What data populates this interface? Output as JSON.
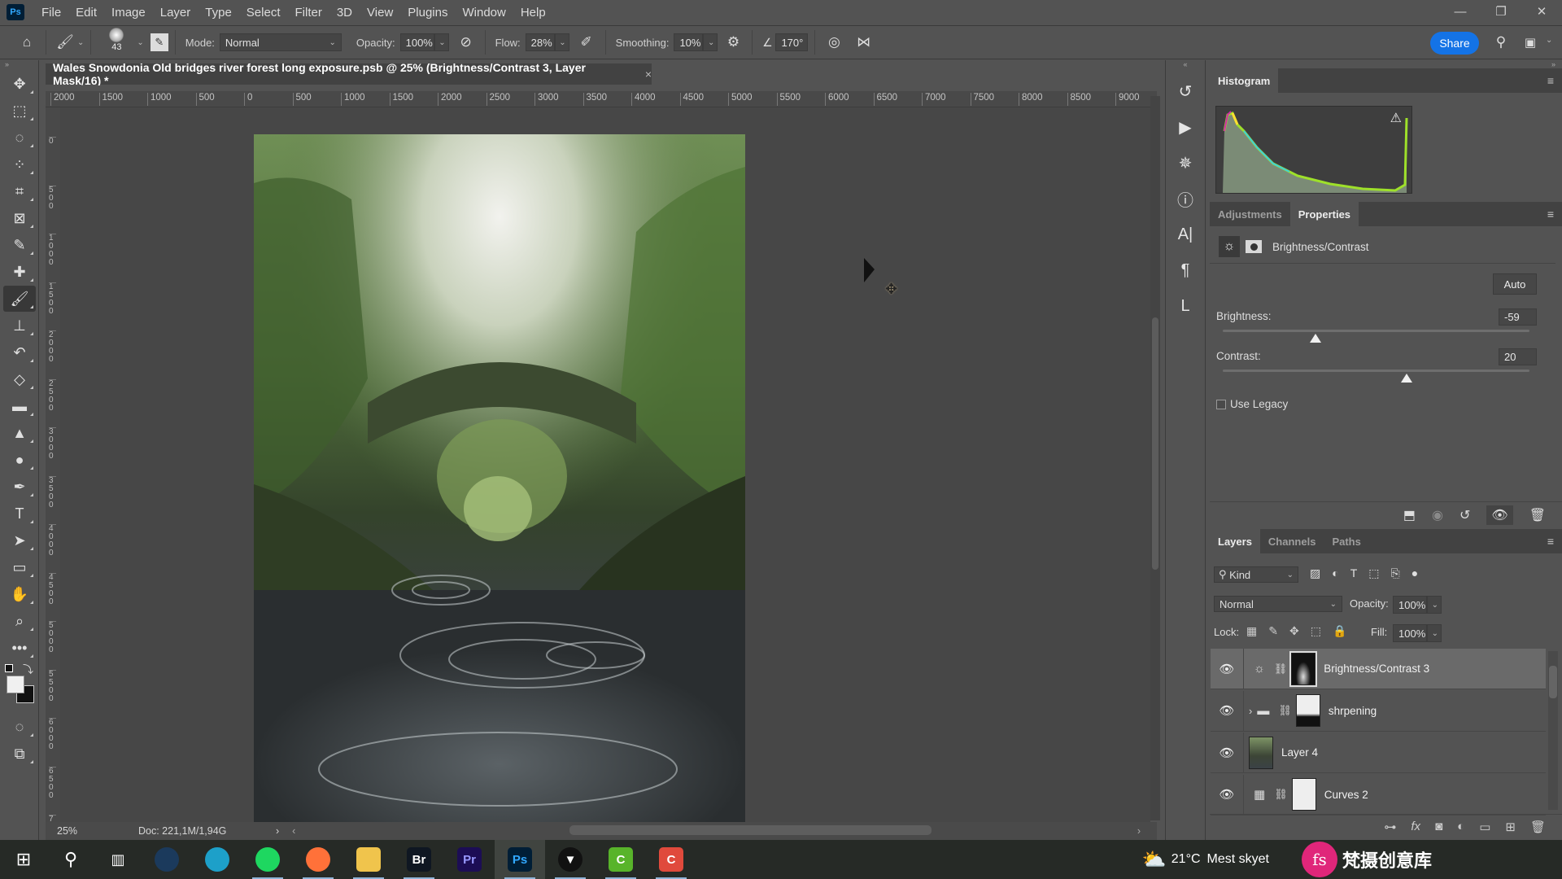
{
  "app": {
    "logo": "Ps",
    "name": "Adobe Photoshop"
  },
  "menu": [
    "File",
    "Edit",
    "Image",
    "Layer",
    "Type",
    "Select",
    "Filter",
    "3D",
    "View",
    "Plugins",
    "Window",
    "Help"
  ],
  "window_controls": {
    "minimize": "—",
    "restore": "❐",
    "close": "✕"
  },
  "options_bar": {
    "brush_size": "43",
    "mode_label": "Mode:",
    "mode_value": "Normal",
    "opacity_label": "Opacity:",
    "opacity_value": "100%",
    "flow_label": "Flow:",
    "flow_value": "28%",
    "smoothing_label": "Smoothing:",
    "smoothing_value": "10%",
    "angle_value": "170°",
    "share_label": "Share"
  },
  "document": {
    "tab_title": "Wales Snowdonia Old bridges river forest long exposure.psb @ 25% (Brightness/Contrast 3, Layer Mask/16) *",
    "close": "×",
    "ruler_h": [
      "2000",
      "1500",
      "1000",
      "500",
      "0",
      "500",
      "1000",
      "1500",
      "2000",
      "2500",
      "3000",
      "3500",
      "4000",
      "4500",
      "5000",
      "5500",
      "6000",
      "6500",
      "7000",
      "7500",
      "8000",
      "8500",
      "9000"
    ],
    "ruler_v": [
      "0",
      "500",
      "1000",
      "1500",
      "2000",
      "2500",
      "3000",
      "3500",
      "4000",
      "4500",
      "5000",
      "5500",
      "6000",
      "6500",
      "7"
    ],
    "zoom": "25%",
    "doc_size": "Doc: 221,1M/1,94G",
    "status_arrow": "›"
  },
  "tools": [
    {
      "name": "move-tool",
      "glyph": "✥"
    },
    {
      "name": "marquee-tool",
      "glyph": "⬚"
    },
    {
      "name": "lasso-tool",
      "glyph": "◌"
    },
    {
      "name": "quick-selection-tool",
      "glyph": "⁘"
    },
    {
      "name": "crop-tool",
      "glyph": "⌗"
    },
    {
      "name": "frame-tool",
      "glyph": "⊠"
    },
    {
      "name": "eyedropper-tool",
      "glyph": "✎"
    },
    {
      "name": "healing-brush-tool",
      "glyph": "✚"
    },
    {
      "name": "brush-tool",
      "glyph": "🖌"
    },
    {
      "name": "clone-stamp-tool",
      "glyph": "⊥"
    },
    {
      "name": "history-brush-tool",
      "glyph": "↶"
    },
    {
      "name": "eraser-tool",
      "glyph": "◇"
    },
    {
      "name": "gradient-tool",
      "glyph": "▬"
    },
    {
      "name": "blur-tool",
      "glyph": "▲"
    },
    {
      "name": "dodge-tool",
      "glyph": "●"
    },
    {
      "name": "pen-tool",
      "glyph": "✒"
    },
    {
      "name": "type-tool",
      "glyph": "T"
    },
    {
      "name": "path-selection-tool",
      "glyph": "➤"
    },
    {
      "name": "rectangle-tool",
      "glyph": "▭"
    },
    {
      "name": "hand-tool",
      "glyph": "✋"
    },
    {
      "name": "zoom-tool",
      "glyph": "⌕"
    },
    {
      "name": "more-tools",
      "glyph": "•••"
    }
  ],
  "colors": {
    "foreground": "#f0f0f0",
    "background": "#111111",
    "accent": "#1473e6"
  },
  "dock": [
    {
      "name": "history-icon",
      "glyph": "↺"
    },
    {
      "name": "actions-play-icon",
      "glyph": "▶"
    },
    {
      "name": "navigator-icon",
      "glyph": "✵"
    },
    {
      "name": "info-icon",
      "glyph": "ⓘ"
    },
    {
      "name": "character-icon",
      "glyph": "A|"
    },
    {
      "name": "paragraph-icon",
      "glyph": "¶"
    },
    {
      "name": "libraries-icon",
      "glyph": "L"
    }
  ],
  "histogram": {
    "tab": "Histogram",
    "warning": "⚠"
  },
  "properties": {
    "tabs": [
      "Adjustments",
      "Properties"
    ],
    "active_tab": "Properties",
    "adjustment_name": "Brightness/Contrast",
    "auto_label": "Auto",
    "brightness_label": "Brightness:",
    "brightness_value": "-59",
    "brightness_fraction": 0.303,
    "contrast_label": "Contrast:",
    "contrast_value": "20",
    "contrast_fraction": 0.6,
    "use_legacy_label": "Use Legacy",
    "use_legacy_checked": false
  },
  "layers_panel": {
    "tabs": [
      "Layers",
      "Channels",
      "Paths"
    ],
    "active_tab": "Layers",
    "filter_kind": "Kind",
    "blend_mode": "Normal",
    "opacity_label": "Opacity:",
    "opacity_value": "100%",
    "lock_label": "Lock:",
    "fill_label": "Fill:",
    "fill_value": "100%",
    "layers": [
      {
        "name": "Brightness/Contrast 3",
        "type": "adjustment-brightness",
        "selected": true,
        "visible": true
      },
      {
        "name": "shrpening",
        "type": "group",
        "selected": false,
        "visible": true
      },
      {
        "name": "Layer 4",
        "type": "pixel",
        "selected": false,
        "visible": true
      },
      {
        "name": "Curves 2",
        "type": "adjustment-curves",
        "selected": false,
        "visible": true
      }
    ]
  },
  "taskbar": {
    "apps": [
      {
        "name": "steam",
        "label": "",
        "color": "#1b3a5c"
      },
      {
        "name": "edge",
        "label": "",
        "color": "#1da0c9"
      },
      {
        "name": "spotify",
        "label": "",
        "color": "#1ed760"
      },
      {
        "name": "firefox",
        "label": "",
        "color": "#ff7139"
      },
      {
        "name": "file-explorer",
        "label": "",
        "color": "#f0c44c"
      },
      {
        "name": "bridge",
        "label": "Br",
        "color": "#0f1722"
      },
      {
        "name": "premiere",
        "label": "Pr",
        "color": "#1c0d55"
      },
      {
        "name": "photoshop",
        "label": "Ps",
        "color": "#001e36"
      },
      {
        "name": "gpu-app",
        "label": "▼",
        "color": "#111"
      },
      {
        "name": "camtasia-green",
        "label": "C",
        "color": "#58b42a"
      },
      {
        "name": "camtasia-red",
        "label": "C",
        "color": "#e04a3c"
      }
    ],
    "weather_temp": "21°C",
    "weather_desc": "Mest skyet",
    "watermark": "梵摄创意库"
  }
}
